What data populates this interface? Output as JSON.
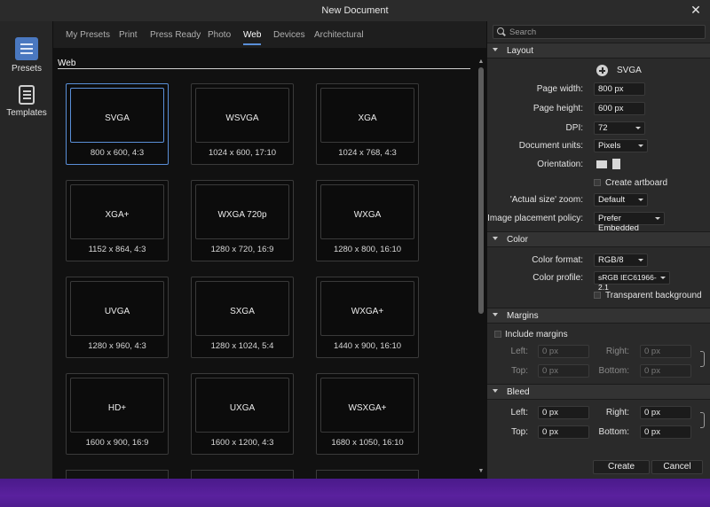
{
  "window": {
    "title": "New Document",
    "close_glyph": "✕"
  },
  "sidebar": {
    "items": [
      {
        "label": "Presets",
        "icon": "presets-icon"
      },
      {
        "label": "Templates",
        "icon": "templates-icon"
      }
    ]
  },
  "tabs": [
    "My Presets",
    "Print",
    "Press Ready",
    "Photo",
    "Web",
    "Devices",
    "Architectural"
  ],
  "active_tab": "Web",
  "section_title": "Web",
  "presets": [
    {
      "name": "SVGA",
      "dims": "800 x 600, 4:3"
    },
    {
      "name": "WSVGA",
      "dims": "1024 x 600, 17:10"
    },
    {
      "name": "XGA",
      "dims": "1024 x 768, 4:3"
    },
    {
      "name": "XGA+",
      "dims": "1152 x 864, 4:3"
    },
    {
      "name": "WXGA 720p",
      "dims": "1280 x 720, 16:9"
    },
    {
      "name": "WXGA",
      "dims": "1280 x 800, 16:10"
    },
    {
      "name": "UVGA",
      "dims": "1280 x 960, 4:3"
    },
    {
      "name": "SXGA",
      "dims": "1280 x 1024, 5:4"
    },
    {
      "name": "WXGA+",
      "dims": "1440 x 900, 16:10"
    },
    {
      "name": "HD+",
      "dims": "1600 x 900, 16:9"
    },
    {
      "name": "UXGA",
      "dims": "1600 x 1200, 4:3"
    },
    {
      "name": "WSXGA+",
      "dims": "1680 x 1050, 16:10"
    }
  ],
  "right": {
    "search_placeholder": "Search",
    "layout": {
      "header": "Layout",
      "preset_name": "SVGA",
      "page_width_label": "Page width:",
      "page_width": "800 px",
      "page_height_label": "Page height:",
      "page_height": "600 px",
      "dpi_label": "DPI:",
      "dpi": "72",
      "units_label": "Document units:",
      "units": "Pixels",
      "orientation_label": "Orientation:",
      "artboard_label": "Create artboard",
      "zoom_label": "'Actual size' zoom:",
      "zoom": "Default",
      "placement_label": "Image placement policy:",
      "placement": "Prefer Embedded"
    },
    "color": {
      "header": "Color",
      "format_label": "Color format:",
      "format": "RGB/8",
      "profile_label": "Color profile:",
      "profile": "sRGB IEC61966-2.1",
      "transparent_label": "Transparent background"
    },
    "margins": {
      "header": "Margins",
      "include_label": "Include margins",
      "left_label": "Left:",
      "left": "0 px",
      "right_label": "Right:",
      "right": "0 px",
      "top_label": "Top:",
      "top": "0 px",
      "bottom_label": "Bottom:",
      "bottom": "0 px"
    },
    "bleed": {
      "header": "Bleed",
      "left_label": "Left:",
      "left": "0 px",
      "right_label": "Right:",
      "right": "0 px",
      "top_label": "Top:",
      "top": "0 px",
      "bottom_label": "Bottom:",
      "bottom": "0 px"
    },
    "buttons": {
      "create": "Create",
      "cancel": "Cancel"
    }
  },
  "colors": {
    "accent": "#5a8fd8",
    "taskbar": "#4a1a8a"
  }
}
